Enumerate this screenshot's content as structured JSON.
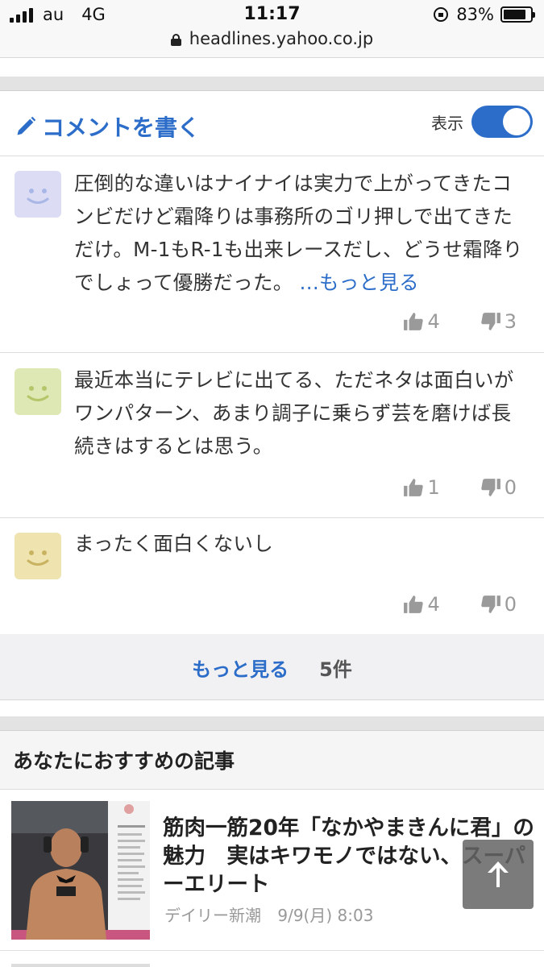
{
  "status_bar": {
    "carrier": "au",
    "network": "4G",
    "time": "11:17",
    "battery": "83%",
    "battery_level": 0.83
  },
  "url_bar": {
    "domain": "headlines.yahoo.co.jp"
  },
  "comments_header": {
    "write_label": "コメントを書く",
    "toggle_label": "表示",
    "toggle_on": true
  },
  "comments": [
    {
      "avatar_color": "#dcdcf4",
      "face_color": "#a9b7e6",
      "text": "圧倒的な違いはナイナイは実力で上がってきたコンビだけど霜降りは事務所のゴリ押しで出てきただけ。M-1もR-1も出来レースだし、どうせ霜降りでしょって優勝だった。",
      "more_label": "...もっと見る",
      "likes": "4",
      "dislikes": "3"
    },
    {
      "avatar_color": "#dde8b4",
      "face_color": "#b5c56a",
      "text": "最近本当にテレビに出てる、ただネタは面白いがワンパターン、あまり調子に乗らず芸を磨けば長続きはするとは思う。",
      "likes": "1",
      "dislikes": "0"
    },
    {
      "avatar_color": "#efe3b0",
      "face_color": "#c9b260",
      "text": "まったく面白くないし",
      "likes": "4",
      "dislikes": "0"
    }
  ],
  "more_bar": {
    "label": "もっと見る",
    "count": "5件"
  },
  "recommendations": {
    "title": "あなたにおすすめの記事",
    "articles": [
      {
        "title": "筋肉一筋20年「なかやまきんに君」の魅力　実はキワモノではない、スーパーエリート",
        "source": "デイリー新潮",
        "date": "9/9(月) 8:03"
      }
    ]
  },
  "colors": {
    "accent": "#2c6dc9",
    "muted": "#9a9a9a"
  }
}
